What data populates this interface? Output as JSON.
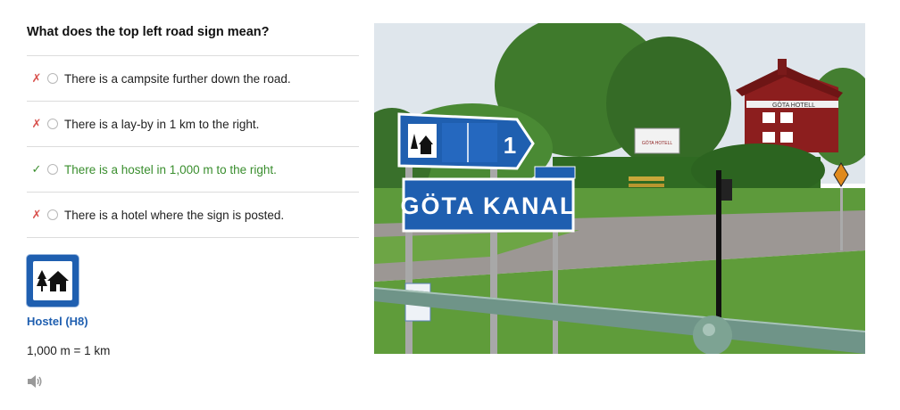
{
  "question": "What does the top left road sign mean?",
  "answers": [
    {
      "text": "There is a campsite further down the road.",
      "mark": "✗",
      "status": "wrong"
    },
    {
      "text": "There is a lay-by in 1 km to the right.",
      "mark": "✗",
      "status": "wrong"
    },
    {
      "text": "There is a hostel in 1,000 m to the right.",
      "mark": "✓",
      "status": "correct"
    },
    {
      "text": "There is a hotel where the sign is posted.",
      "mark": "✗",
      "status": "wrong"
    }
  ],
  "sign": {
    "caption": "Hostel (H8)",
    "icon": "hostel-sign-icon"
  },
  "note": "1,000 m = 1 km",
  "audio": {
    "icon": "speaker-icon"
  },
  "photo": {
    "direction_sign_number": "1",
    "main_sign_text": "GÖTA KANAL",
    "building_sign_text": "GÖTA HOTELL",
    "billboard_text": "GÖTA HOTELL"
  },
  "colors": {
    "correct": "#3a8e2e",
    "wrong": "#d9534f",
    "sign_blue": "#1f5fb0"
  }
}
